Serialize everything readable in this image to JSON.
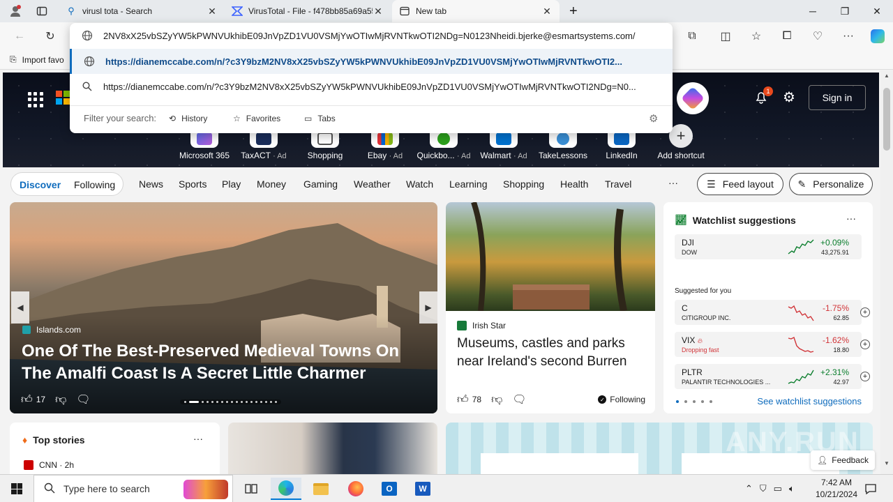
{
  "browser": {
    "tabs": [
      {
        "label": "virusl tota - Search",
        "icon": "search-icon"
      },
      {
        "label": "VirusTotal - File - f478bb85a69a55",
        "icon": "virustotal-icon"
      },
      {
        "label": "New tab",
        "icon": "newtab-icon"
      }
    ],
    "new_tab_symbol": "+",
    "close_symbol": "✕",
    "bookmarks_label": "Import favo"
  },
  "omnibox": {
    "input_value": "/2NV8xX25vbSZyYW5kPWNVUkhibE09JnVpZD1VU0VSMjYwOTIwMjRVNTkwOTI2NDg=N0123Nheidi.bjerke@esmartsystems.com",
    "suggestions": [
      "https://dianemccabe.com/n/?c3Y9bzM2NV8xX25vbSZyYW5kPWNVUkhibE09JnVpZD1VU0VSMjYwOTIwMjRVNTkwOTI2...",
      "https://dianemccabe.com/n/?c3Y9bzM2NV8xX25vbSZyYW5kPWNVUkhibE09JnVpZD1VU0VSMjYwOTIwMjRVNTkwOTI2NDg=N0..."
    ],
    "filter_label": "Filter your search:",
    "filters": [
      "History",
      "Favorites",
      "Tabs"
    ]
  },
  "header": {
    "notification_count": "1",
    "sign_in": "Sign in"
  },
  "shortcuts": [
    {
      "label": "Microsoft 365",
      "ad": ""
    },
    {
      "label": "TaxACT",
      "ad": "· Ad"
    },
    {
      "label": "Shopping",
      "ad": ""
    },
    {
      "label": "Ebay",
      "ad": "· Ad"
    },
    {
      "label": "Quickbo...",
      "ad": "· Ad"
    },
    {
      "label": "Walmart",
      "ad": "· Ad"
    },
    {
      "label": "TakeLessons",
      "ad": ""
    },
    {
      "label": "LinkedIn",
      "ad": ""
    },
    {
      "label": "Add shortcut",
      "ad": ""
    }
  ],
  "nav": {
    "discover": "Discover",
    "following": "Following",
    "items": [
      "News",
      "Sports",
      "Play",
      "Money",
      "Gaming",
      "Weather",
      "Watch",
      "Learning",
      "Shopping",
      "Health",
      "Travel"
    ],
    "more": "···",
    "feed_layout": "Feed layout",
    "personalize": "Personalize"
  },
  "hero": {
    "source": "Islands.com",
    "title": "One Of The Best-Preserved Medieval Towns On The Amalfi Coast Is A Secret Little Charmer",
    "likes": "17"
  },
  "mid_card": {
    "source": "Irish Star",
    "title": "Museums, castles and parks near Ireland's second Burren",
    "likes": "78",
    "following": "Following"
  },
  "watchlist": {
    "title": "Watchlist suggestions",
    "more": "···",
    "main": {
      "symbol": "DJI",
      "name": "DOW",
      "change": "+0.09%",
      "price": "43,275.91"
    },
    "suggested_label": "Suggested for you",
    "stocks": [
      {
        "symbol": "C",
        "name": "CITIGROUP INC.",
        "change": "-1.75%",
        "price": "62.85",
        "note": ""
      },
      {
        "symbol": "VIX",
        "name": "Dropping fast",
        "change": "-1.62%",
        "price": "18.80",
        "note": ""
      },
      {
        "symbol": "PLTR",
        "name": "PALANTIR TECHNOLOGIES ...",
        "change": "+2.31%",
        "price": "42.97",
        "note": ""
      }
    ],
    "link": "See watchlist suggestions"
  },
  "top_stories": {
    "title": "Top stories",
    "more": "···",
    "source": "CNN · 2h"
  },
  "feedback": "Feedback",
  "watermark": "ANY.RUN",
  "taskbar": {
    "search_placeholder": "Type here to search",
    "time": "7:42 AM",
    "date": "10/21/2024"
  },
  "colors": {
    "accent": "#0f6cbd",
    "up": "#0a7d2c",
    "down": "#d13438"
  }
}
